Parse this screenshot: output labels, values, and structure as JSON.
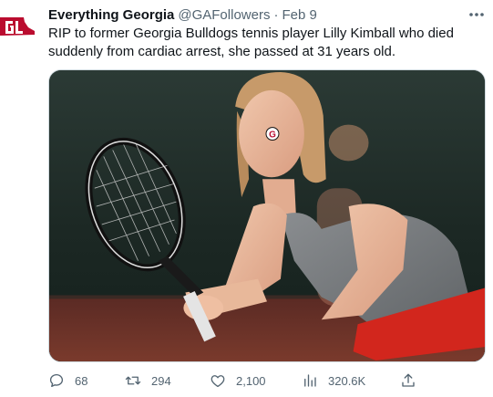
{
  "tweet": {
    "author": {
      "display_name": "Everything Georgia",
      "handle": "@GAFollowers",
      "separator": "·",
      "date": "Feb 9",
      "avatar_icon": "georgia-g-logo-icon",
      "avatar_color": "#ba0c2f"
    },
    "text": "RIP to former Georgia Bulldogs tennis player Lilly Kimball who died suddenly from cardiac arrest, she passed at 31 years old.",
    "more_icon": "more-horizontal-icon",
    "media": {
      "type": "photo",
      "badge_letter": "G"
    },
    "actions": {
      "replies": "68",
      "retweets": "294",
      "likes": "2,100",
      "views": "320.6K",
      "reply_icon": "reply-icon",
      "retweet_icon": "retweet-icon",
      "like_icon": "heart-icon",
      "views_icon": "analytics-icon",
      "share_icon": "share-icon"
    },
    "colors": {
      "text": "#0f1419",
      "secondary": "#536471",
      "border": "#cfd9de"
    }
  }
}
